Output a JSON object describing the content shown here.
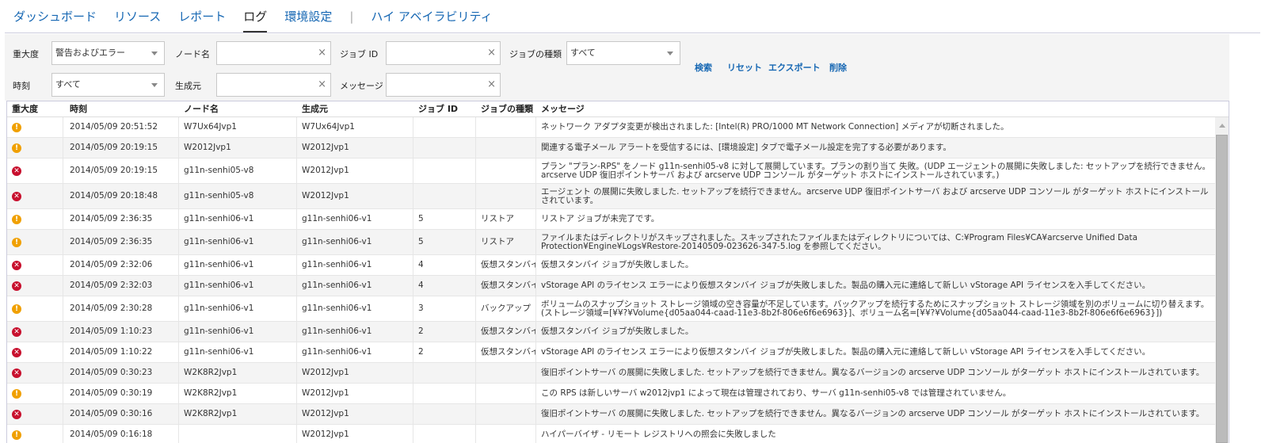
{
  "nav": {
    "items": [
      "ダッシュボード",
      "リソース",
      "レポート",
      "ログ",
      "環境設定"
    ],
    "separator": "|",
    "ha": "ハイ アベイラビリティ",
    "active": "ログ"
  },
  "filters": {
    "severity_label": "重大度",
    "severity_value": "警告およびエラー",
    "node_label": "ノード名",
    "node_value": "",
    "jobid_label": "ジョブ ID",
    "jobid_value": "",
    "jobtype_label": "ジョブの種類",
    "jobtype_value": "すべて",
    "time_label": "時刻",
    "time_value": "すべて",
    "generator_label": "生成元",
    "generator_value": "",
    "message_label": "メッセージ",
    "message_value": "",
    "clear_icon": "×",
    "actions": {
      "search": "検索",
      "reset": "リセット",
      "export": "エクスポート",
      "delete": "削除"
    }
  },
  "table": {
    "headers": [
      "重大度",
      "時刻",
      "ノード名",
      "生成元",
      "ジョブ ID",
      "ジョブの種類",
      "メッセージ"
    ],
    "rows": [
      {
        "sev": "warning",
        "time": "2014/05/09 20:51:52",
        "node": "W7Ux64Jvp1",
        "gen": "W7Ux64Jvp1",
        "jobid": "",
        "type": "",
        "msg": "ネットワーク アダプタ変更が検出されました: [Intel(R) PRO/1000 MT Network Connection] メディアが切断されました。"
      },
      {
        "sev": "warning",
        "time": "2014/05/09 20:19:15",
        "node": "W2012Jvp1",
        "gen": "W2012Jvp1",
        "jobid": "",
        "type": "",
        "msg": "関連する電子メール アラートを受信するには、[環境設定] タブで電子メール設定を完了する必要があります。"
      },
      {
        "sev": "error",
        "time": "2014/05/09 20:19:15",
        "node": "g11n-senhi05-v8",
        "gen": "W2012Jvp1",
        "jobid": "",
        "type": "",
        "msg": "プラン \"プラン-RPS\" をノード g11n-senhi05-v8 に対して展開しています。プランの割り当て 失敗。(UDP エージェントの展開に失敗しました: セットアップを続行できません。arcserve UDP 復旧ポイントサーバ および arcserve UDP コンソール がターゲット ホストにインストールされています。)"
      },
      {
        "sev": "error",
        "time": "2014/05/09 20:18:48",
        "node": "g11n-senhi05-v8",
        "gen": "W2012Jvp1",
        "jobid": "",
        "type": "",
        "msg": "エージェント の展開に失敗しました. セットアップを続行できません。arcserve UDP 復旧ポイントサーバ および arcserve UDP コンソール がターゲット ホストにインストールされています。"
      },
      {
        "sev": "warning",
        "time": "2014/05/09 2:36:35",
        "node": "g11n-senhi06-v1",
        "gen": "g11n-senhi06-v1",
        "jobid": "5",
        "type": "リストア",
        "msg": "リストア ジョブが未完了です。"
      },
      {
        "sev": "warning",
        "time": "2014/05/09 2:36:35",
        "node": "g11n-senhi06-v1",
        "gen": "g11n-senhi06-v1",
        "jobid": "5",
        "type": "リストア",
        "msg": "ファイルまたはディレクトリがスキップされました。スキップされたファイルまたはディレクトリについては、C:¥Program Files¥CA¥arcserve Unified Data Protection¥Engine¥Logs¥Restore-20140509-023626-347-5.log を参照してください。"
      },
      {
        "sev": "error",
        "time": "2014/05/09 2:32:06",
        "node": "g11n-senhi06-v1",
        "gen": "g11n-senhi06-v1",
        "jobid": "4",
        "type": "仮想スタンバイ",
        "msg": "仮想スタンバイ ジョブが失敗しました。"
      },
      {
        "sev": "error",
        "time": "2014/05/09 2:32:03",
        "node": "g11n-senhi06-v1",
        "gen": "g11n-senhi06-v1",
        "jobid": "4",
        "type": "仮想スタンバイ",
        "msg": "vStorage API のライセンス エラーにより仮想スタンバイ ジョブが失敗しました。製品の購入元に連絡して新しい vStorage API ライセンスを入手してください。"
      },
      {
        "sev": "warning",
        "time": "2014/05/09 2:30:28",
        "node": "g11n-senhi06-v1",
        "gen": "g11n-senhi06-v1",
        "jobid": "3",
        "type": "バックアップ",
        "msg": "ボリュームのスナップショット ストレージ領域の空き容量が不足しています。バックアップを続行するためにスナップショット ストレージ領域を別のボリュームに切り替えます。(ストレージ領域=[¥¥?¥Volume{d05aa044-caad-11e3-8b2f-806e6f6e6963}]、ボリューム名=[¥¥?¥Volume{d05aa044-caad-11e3-8b2f-806e6f6e6963}])"
      },
      {
        "sev": "error",
        "time": "2014/05/09 1:10:23",
        "node": "g11n-senhi06-v1",
        "gen": "g11n-senhi06-v1",
        "jobid": "2",
        "type": "仮想スタンバイ",
        "msg": "仮想スタンバイ ジョブが失敗しました。"
      },
      {
        "sev": "error",
        "time": "2014/05/09 1:10:22",
        "node": "g11n-senhi06-v1",
        "gen": "g11n-senhi06-v1",
        "jobid": "2",
        "type": "仮想スタンバイ",
        "msg": "vStorage API のライセンス エラーにより仮想スタンバイ ジョブが失敗しました。製品の購入元に連絡して新しい vStorage API ライセンスを入手してください。"
      },
      {
        "sev": "error",
        "time": "2014/05/09 0:30:23",
        "node": "W2K8R2Jvp1",
        "gen": "W2012Jvp1",
        "jobid": "",
        "type": "",
        "msg": "復旧ポイントサーバ の展開に失敗しました. セットアップを続行できません。異なるバージョンの arcserve UDP コンソール がターゲット ホストにインストールされています。"
      },
      {
        "sev": "warning",
        "time": "2014/05/09 0:30:19",
        "node": "W2K8R2Jvp1",
        "gen": "W2012Jvp1",
        "jobid": "",
        "type": "",
        "msg": "この RPS は新しいサーバ w2012jvp1 によって現在は管理されており、サーバ g11n-senhi05-v8 では管理されていません。"
      },
      {
        "sev": "error",
        "time": "2014/05/09 0:30:16",
        "node": "W2K8R2Jvp1",
        "gen": "W2012Jvp1",
        "jobid": "",
        "type": "",
        "msg": "復旧ポイントサーバ の展開に失敗しました. セットアップを続行できません。異なるバージョンの arcserve UDP コンソール がターゲット ホストにインストールされています。"
      },
      {
        "sev": "warning",
        "time": "2014/05/09 0:16:18",
        "node": "",
        "gen": "W2012Jvp1",
        "jobid": "",
        "type": "",
        "msg": "ハイパーバイザ - リモート レジストリへの照会に失敗しました"
      }
    ]
  },
  "colors": {
    "link": "#1667b3",
    "warning": "#f0a000",
    "error": "#c8102e"
  }
}
